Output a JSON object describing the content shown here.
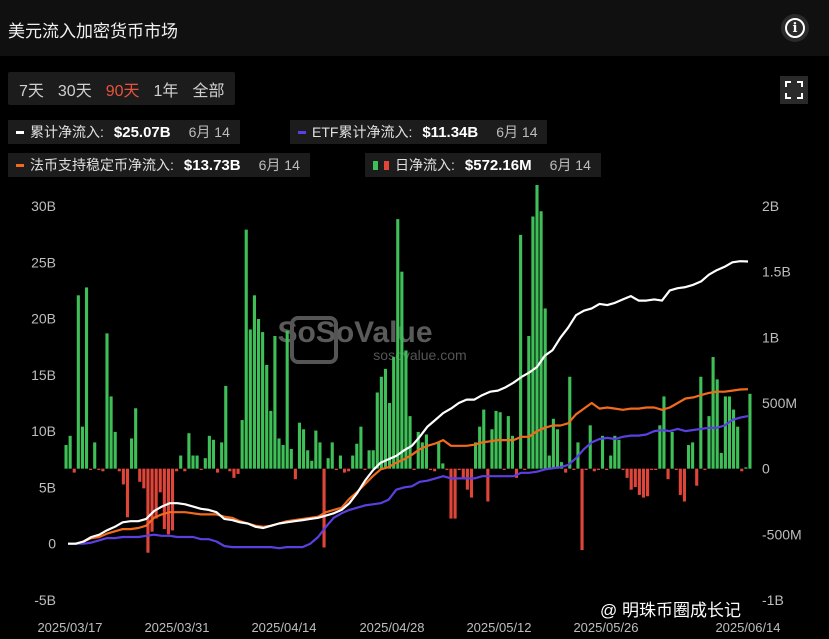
{
  "header": {
    "title": "美元流入加密货币市场",
    "info_icon": "info-icon"
  },
  "tabs": [
    {
      "label": "7天",
      "active": false
    },
    {
      "label": "30天",
      "active": false
    },
    {
      "label": "90天",
      "active": true
    },
    {
      "label": "1年",
      "active": false
    },
    {
      "label": "全部",
      "active": false
    }
  ],
  "legend": [
    {
      "label": "累计净流入:",
      "value": "$25.07B",
      "date": "6月 14",
      "color": "#ffffff"
    },
    {
      "label": "ETF累计净流入:",
      "value": "$11.34B",
      "date": "6月 14",
      "color": "#5b3fe0"
    },
    {
      "label": "法币支持稳定币净流入:",
      "value": "$13.73B",
      "date": "6月 14",
      "color": "#f26b1d"
    },
    {
      "label": "日净流入:",
      "value": "$572.16M",
      "date": "6月 14",
      "color_pos": "#3fbf57",
      "color_neg": "#e0453a"
    }
  ],
  "watermark": {
    "brand": "SoSoValue",
    "url": "sosovalue.com",
    "source": "@ 明珠币圈成长记"
  },
  "chart_data": {
    "type": "bar+line",
    "x_ticks": [
      "2025/03/17",
      "2025/03/31",
      "2025/04/14",
      "2025/04/28",
      "2025/05/12",
      "2025/05/26",
      "2025/06/14"
    ],
    "y_left": {
      "ticks": [
        "30B",
        "25B",
        "20B",
        "15B",
        "10B",
        "5B",
        "0",
        "-5B"
      ],
      "range": [
        -5,
        30
      ],
      "unit": "B"
    },
    "y_right": {
      "ticks": [
        "2B",
        "1.5B",
        "1B",
        "500M",
        "0",
        "-500M",
        "-1B"
      ],
      "range": [
        -1000,
        2000
      ],
      "unit": "M"
    },
    "daily_net_flow_M": [
      180,
      250,
      -30,
      1320,
      320,
      1380,
      -10,
      200,
      -10,
      -20,
      1030,
      550,
      280,
      -20,
      -120,
      -370,
      230,
      460,
      -100,
      -150,
      -640,
      -480,
      -380,
      -180,
      -460,
      -500,
      -470,
      -20,
      100,
      -20,
      270,
      100,
      100,
      -10,
      80,
      250,
      220,
      -30,
      200,
      630,
      -20,
      -70,
      -40,
      370,
      1820,
      1060,
      1320,
      1140,
      1040,
      790,
      440,
      1010,
      230,
      180,
      1050,
      150,
      -80,
      350,
      300,
      140,
      60,
      290,
      200,
      -600,
      80,
      200,
      -10,
      100,
      -30,
      -20,
      100,
      190,
      320,
      -10,
      140,
      140,
      580,
      700,
      760,
      500,
      850,
      1900,
      1500,
      900,
      400,
      -10,
      280,
      200,
      260,
      -10,
      -20,
      200,
      40,
      -10,
      -380,
      -380,
      -10,
      -70,
      -160,
      -220,
      200,
      320,
      450,
      -250,
      300,
      440,
      430,
      -10,
      400,
      250,
      -70,
      1780,
      -10,
      1010,
      1920,
      2160,
      1960,
      1220,
      100,
      380,
      300,
      50,
      -30,
      700,
      -10,
      200,
      -620,
      -10,
      330,
      -20,
      -10,
      250,
      -10,
      100,
      250,
      220,
      -10,
      -70,
      -160,
      -140,
      -200,
      -220,
      -210,
      -10,
      -10,
      330,
      550,
      -80,
      280,
      -10,
      -200,
      -250,
      180,
      200,
      -130,
      700,
      -10,
      400,
      850,
      680,
      120,
      550,
      550,
      450,
      320,
      -20,
      10,
      570
    ]
  }
}
